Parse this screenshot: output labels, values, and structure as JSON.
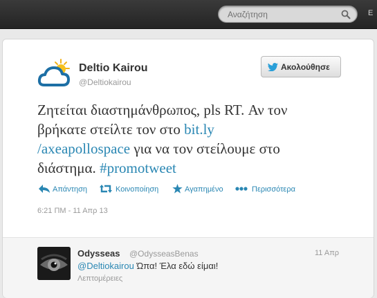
{
  "topbar": {
    "search_placeholder": "Αναζήτηση",
    "edge_text": "Ε"
  },
  "tweet": {
    "author_name": "Deltio Kairou",
    "author_handle": "@Deltiokairou",
    "follow_label": "Ακολούθησε",
    "text_line1": "Ζητείται διαστημάνθρωπος, pls RT. Αν τον",
    "text_line2_prefix": "βρήκατε στείλτε τον στο ",
    "link_part1": "bit.ly",
    "link_part2": "/axeapollospace",
    "text_line3_suffix": " για να τον στείλουμε στο",
    "text_line4_prefix": "διάστημα. ",
    "hashtag": "#promotweet",
    "actions": {
      "reply": "Απάντηση",
      "retweet": "Κοινοποίηση",
      "favorite": "Αγαπημένο",
      "more": "Περισσότερα"
    },
    "timestamp": "6:21 ΠΜ - 11 Απρ 13"
  },
  "reply": {
    "author_name": "Odysseas",
    "author_handle": "@OdysseasBenas",
    "date": "11 Απρ",
    "mention": "@Deltiokairou",
    "text": " Ώπα! Έλα εδώ είμαι!",
    "details": "Λεπτομέρειες"
  },
  "colors": {
    "link": "#2a87b3",
    "text": "#333333",
    "muted": "#999999",
    "topbar": "#2e2e2e"
  },
  "icons": {
    "search": "magnifier-icon",
    "follow": "twitter-bird-icon",
    "reply": "reply-arrow-icon",
    "retweet": "retweet-icon",
    "favorite": "star-icon",
    "more": "ellipsis-icon"
  }
}
